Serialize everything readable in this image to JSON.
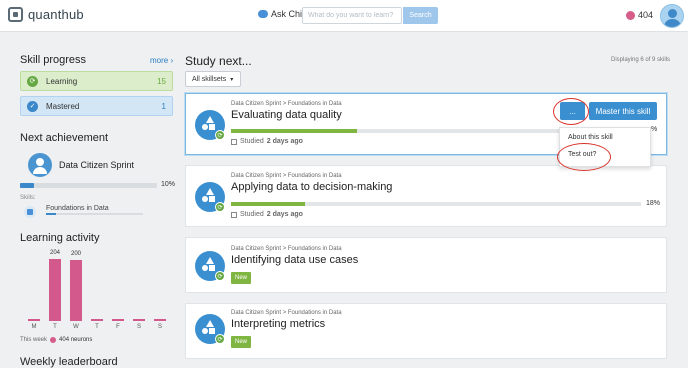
{
  "header": {
    "logo_text": "quanthub",
    "ask_chip": "Ask Chip",
    "search_placeholder": "What do you want to learn?",
    "search_button": "Search",
    "neurons": "404"
  },
  "skill_progress": {
    "title": "Skill progress",
    "more": "more",
    "learning_label": "Learning",
    "learning_count": "15",
    "mastered_label": "Mastered",
    "mastered_count": "1"
  },
  "next_achievement": {
    "title": "Next achievement",
    "name": "Data Citizen Sprint",
    "progress": 0.1,
    "progress_label": "10%",
    "skills_label": "Skills:",
    "skill_name": "Foundations in Data",
    "skill_progress": 0.1
  },
  "learning_activity": {
    "title": "Learning activity",
    "days": [
      "M",
      "T",
      "W",
      "T",
      "F",
      "S",
      "S"
    ],
    "values": [
      0,
      204,
      200,
      0,
      0,
      0,
      0
    ],
    "value_labels": [
      "",
      "204",
      "200",
      "",
      "",
      "",
      ""
    ],
    "this_week_label": "This week",
    "this_week_value": "404 neurons"
  },
  "leaderboard": {
    "title": "Weekly leaderboard"
  },
  "study_next": {
    "title": "Study next...",
    "displaying": "Displaying 6 of 9 skills",
    "filter": "All skillsets",
    "cards": [
      {
        "crumb": "Data Citizen Sprint > Foundations in Data",
        "title": "Evaluating data quality",
        "progress": 0.3,
        "pct": "%",
        "studied_prefix": "Studied",
        "studied_when": "2 days ago",
        "dots": "...",
        "master": "Master this skill"
      },
      {
        "crumb": "Data Citizen Sprint > Foundations in Data",
        "title": "Applying data to decision-making",
        "progress": 0.18,
        "pct": "18%",
        "studied_prefix": "Studied",
        "studied_when": "2 days ago"
      },
      {
        "crumb": "Data Citizen Sprint > Foundations in Data",
        "title": "Identifying data use cases",
        "badge": "New"
      },
      {
        "crumb": "Data Citizen Sprint > Foundations in Data",
        "title": "Interpreting metrics",
        "badge": "New"
      }
    ]
  },
  "dropdown": {
    "items": [
      "About this skill",
      "Test out?"
    ]
  },
  "colors": {
    "accent": "#3a8fd0",
    "learning_green": "#7fb642",
    "neuron_pink": "#d3588b",
    "annotation_red": "#d9312a"
  }
}
